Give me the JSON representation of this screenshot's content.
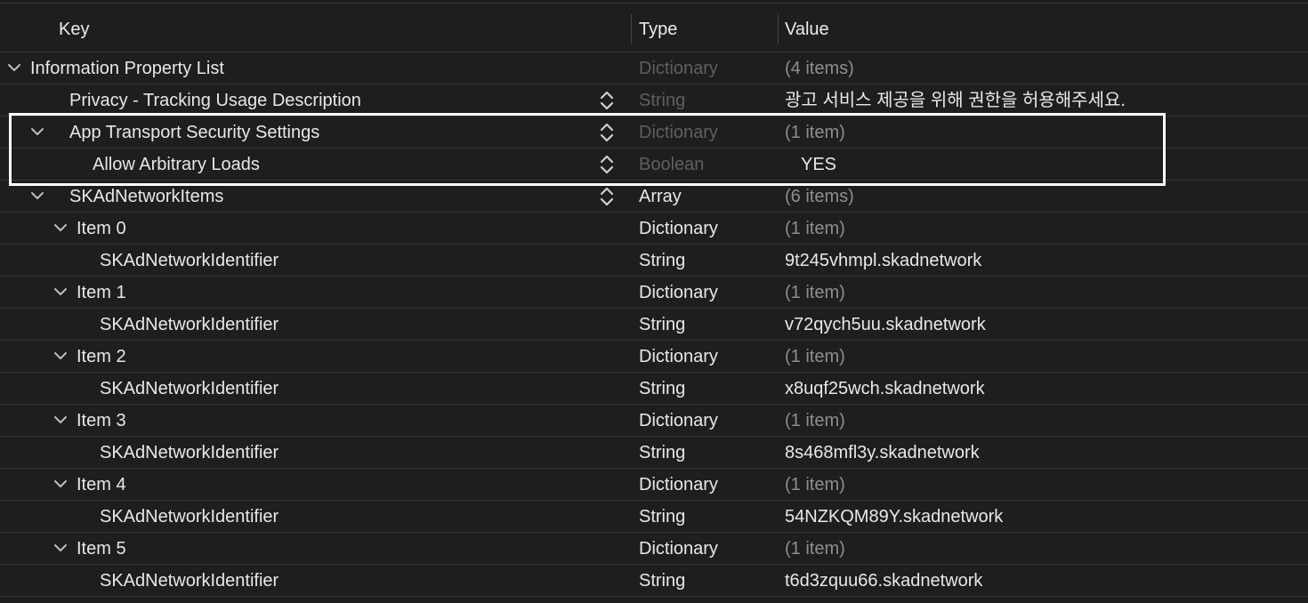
{
  "header": {
    "key_label": "Key",
    "type_label": "Type",
    "value_label": "Value"
  },
  "rows": [
    {
      "key": "Information Property List",
      "type": "Dictionary",
      "value": "(4 items)"
    },
    {
      "key": "Privacy - Tracking Usage Description",
      "type": "String",
      "value": "광고 서비스 제공을 위해 권한을 허용해주세요."
    },
    {
      "key": "App Transport Security Settings",
      "type": "Dictionary",
      "value": "(1 item)"
    },
    {
      "key": "Allow Arbitrary Loads",
      "type": "Boolean",
      "value": "YES"
    },
    {
      "key": "SKAdNetworkItems",
      "type": "Array",
      "value": "(6 items)"
    },
    {
      "key": "Item 0",
      "type": "Dictionary",
      "value": "(1 item)"
    },
    {
      "key": "SKAdNetworkIdentifier",
      "type": "String",
      "value": "9t245vhmpl.skadnetwork"
    },
    {
      "key": "Item 1",
      "type": "Dictionary",
      "value": "(1 item)"
    },
    {
      "key": "SKAdNetworkIdentifier",
      "type": "String",
      "value": "v72qych5uu.skadnetwork"
    },
    {
      "key": "Item 2",
      "type": "Dictionary",
      "value": "(1 item)"
    },
    {
      "key": "SKAdNetworkIdentifier",
      "type": "String",
      "value": "x8uqf25wch.skadnetwork"
    },
    {
      "key": "Item 3",
      "type": "Dictionary",
      "value": "(1 item)"
    },
    {
      "key": "SKAdNetworkIdentifier",
      "type": "String",
      "value": "8s468mfl3y.skadnetwork"
    },
    {
      "key": "Item 4",
      "type": "Dictionary",
      "value": "(1 item)"
    },
    {
      "key": "SKAdNetworkIdentifier",
      "type": "String",
      "value": "54NZKQM89Y.skadnetwork"
    },
    {
      "key": "Item 5",
      "type": "Dictionary",
      "value": "(1 item)"
    },
    {
      "key": "SKAdNetworkIdentifier",
      "type": "String",
      "value": "t6d3zquu66.skadnetwork"
    }
  ],
  "colors": {
    "background": "#1e1e1e",
    "text": "#e8e8e8",
    "dim_type": "#5f5f5f",
    "count_text": "#8e8e8e",
    "highlight": "#ffffff"
  },
  "icons": {
    "disclosure": "chevron-down-icon",
    "stepper": "up-down-stepper-icon"
  }
}
